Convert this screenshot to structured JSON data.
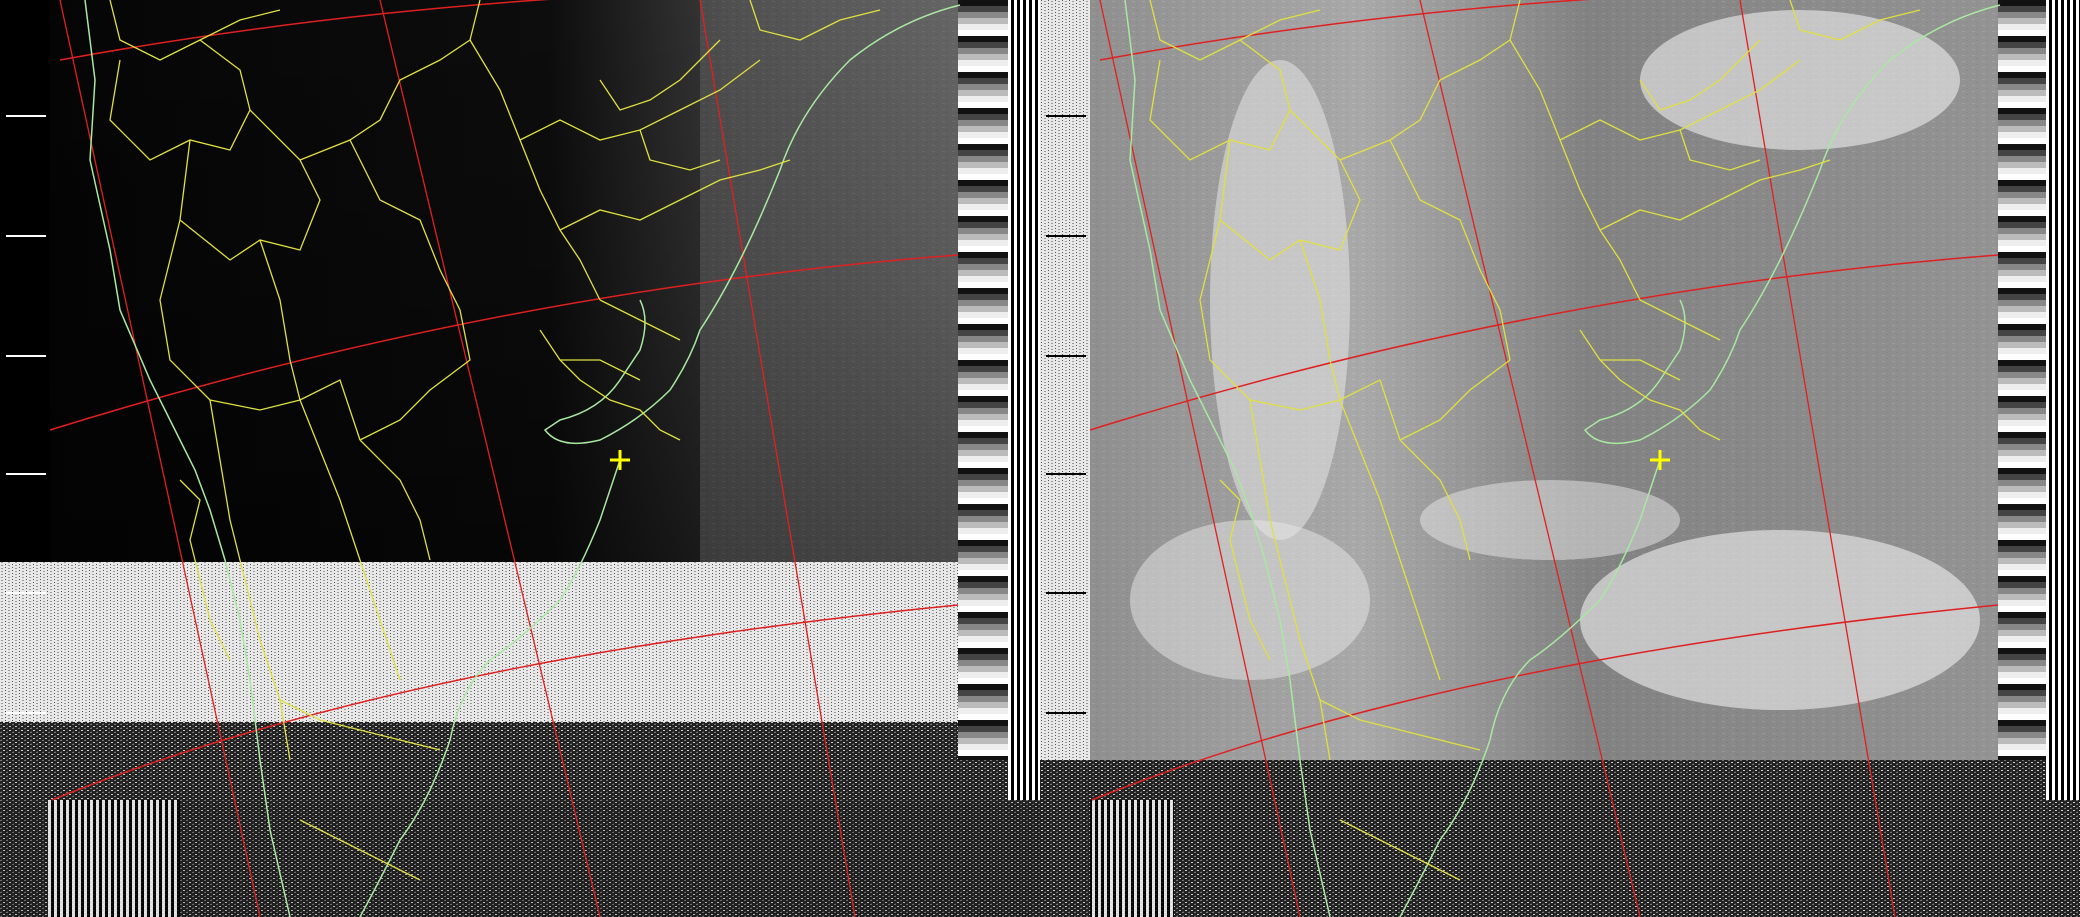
{
  "image": {
    "kind": "NOAA APT weather satellite image with map overlay (two channels side by side)",
    "channels": [
      {
        "name": "channel-a",
        "tone": "dark"
      },
      {
        "name": "channel-b",
        "tone": "light"
      }
    ],
    "colors": {
      "background": "#000000",
      "grid_lines": "#e02020",
      "political_borders": "#e0e040",
      "coastline": "#a8e8a0",
      "station_marker": "#ffff00",
      "noise_light": "#f2f2f2",
      "cloud_gray": "#8a8a8a"
    },
    "icons": [
      "station-marker-icon"
    ]
  }
}
